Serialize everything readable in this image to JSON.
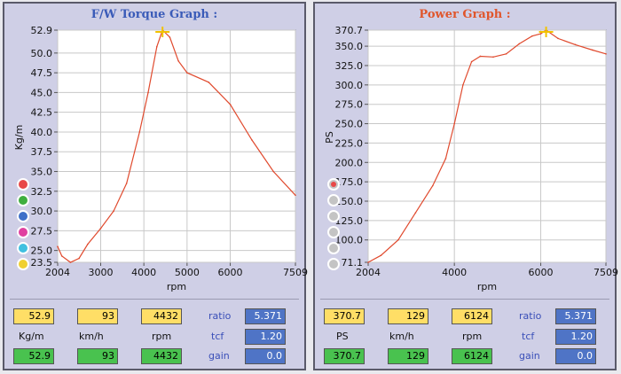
{
  "panels": [
    {
      "title": "F/W Torque Graph :",
      "title_color": "#3a5bb8",
      "readout": {
        "values": [
          "52.9",
          "93",
          "4432"
        ],
        "units": [
          "Kg/m",
          "km/h",
          "rpm"
        ],
        "gain_values": [
          "52.9",
          "93",
          "4432"
        ]
      }
    },
    {
      "title": "Power Graph :",
      "title_color": "#e0562c",
      "readout": {
        "values": [
          "370.7",
          "129",
          "6124"
        ],
        "units": [
          "PS",
          "km/h",
          "rpm"
        ],
        "gain_values": [
          "370.7",
          "129",
          "6124"
        ]
      }
    }
  ],
  "params": {
    "ratio_label": "ratio",
    "ratio_value": "5.371",
    "tcf_label": "tcf",
    "tcf_value": "1.20",
    "gain_label": "gain",
    "gain_value": "0.0"
  },
  "chart_data": [
    {
      "type": "line",
      "title": "F/W Torque Graph :",
      "xlabel": "rpm",
      "ylabel": "Kg/m",
      "xlim": [
        2004,
        7509
      ],
      "ylim": [
        23.5,
        52.9
      ],
      "x_ticks": [
        "2004",
        "3000",
        "4000",
        "5000",
        "6000",
        "7509"
      ],
      "y_ticks": [
        "52.9",
        "50.0",
        "47.5",
        "45.0",
        "42.5",
        "40.0",
        "37.5",
        "35.0",
        "32.5",
        "30.0",
        "27.5",
        "25.0",
        "23.5"
      ],
      "grid": true,
      "line_color": "#e04a2e",
      "marker_x": 4432,
      "series": [
        {
          "x": [
            2004,
            2100,
            2300,
            2500,
            2700,
            3000,
            3300,
            3600,
            3900,
            4100,
            4300,
            4432,
            4600,
            4800,
            5000,
            5500,
            6000,
            6500,
            7000,
            7509
          ],
          "y": [
            25.5,
            24.3,
            23.5,
            24.0,
            25.8,
            27.8,
            30.0,
            33.5,
            40.0,
            45.0,
            50.8,
            52.9,
            52.0,
            49.0,
            47.5,
            46.3,
            43.5,
            39.0,
            35.0,
            32.0
          ]
        }
      ]
    },
    {
      "type": "line",
      "title": "Power Graph :",
      "xlabel": "rpm",
      "ylabel": "PS",
      "xlim": [
        2004,
        7509
      ],
      "ylim": [
        71.1,
        370.7
      ],
      "x_ticks": [
        "2004",
        "4000",
        "6000",
        "7509"
      ],
      "y_ticks": [
        "370.7",
        "350.0",
        "325.0",
        "300.0",
        "275.0",
        "250.0",
        "225.0",
        "200.0",
        "175.0",
        "150.0",
        "125.0",
        "100.0",
        "71.1"
      ],
      "grid": true,
      "line_color": "#e04a2e",
      "marker_x": 6124,
      "series": [
        {
          "x": [
            2004,
            2300,
            2700,
            3100,
            3500,
            3800,
            4000,
            4200,
            4400,
            4600,
            4900,
            5200,
            5500,
            5800,
            6000,
            6124,
            6400,
            6800,
            7200,
            7509
          ],
          "y": [
            71.1,
            80.0,
            100.0,
            135.0,
            170.0,
            205.0,
            250.0,
            300.0,
            330.0,
            337.0,
            336.0,
            340.0,
            353.0,
            363.0,
            366.0,
            370.7,
            360.0,
            352.0,
            345.0,
            340.0
          ]
        }
      ]
    }
  ]
}
